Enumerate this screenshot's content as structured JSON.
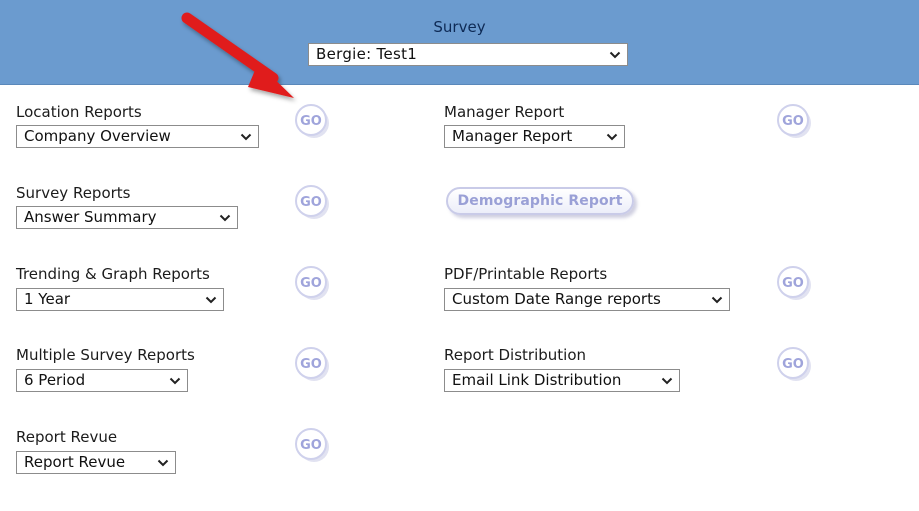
{
  "header": {
    "title": "Survey",
    "survey_select": "Bergie: Test1"
  },
  "colors": {
    "header_bg": "#6b9bcf",
    "go_text": "#9fa4db",
    "arrow": "#e01b1b"
  },
  "go_label": "GO",
  "reports": [
    {
      "label": "Location Reports",
      "selected": "Company Overview"
    },
    {
      "label": "Survey Reports",
      "selected": "Answer Summary"
    },
    {
      "label": "Trending & Graph Reports",
      "selected": "1 Year"
    },
    {
      "label": "Multiple Survey Reports",
      "selected": "6 Period"
    },
    {
      "label": "Report Revue",
      "selected": "Report Revue"
    },
    {
      "label": "Manager Report",
      "selected": "Manager Report"
    },
    {
      "label": "PDF/Printable Reports",
      "selected": "Custom Date Range reports"
    },
    {
      "label": "Report Distribution",
      "selected": "Email Link Distribution"
    }
  ],
  "demographic_button": "Demographic Report",
  "annotation": {
    "icon": "red-arrow-icon"
  }
}
